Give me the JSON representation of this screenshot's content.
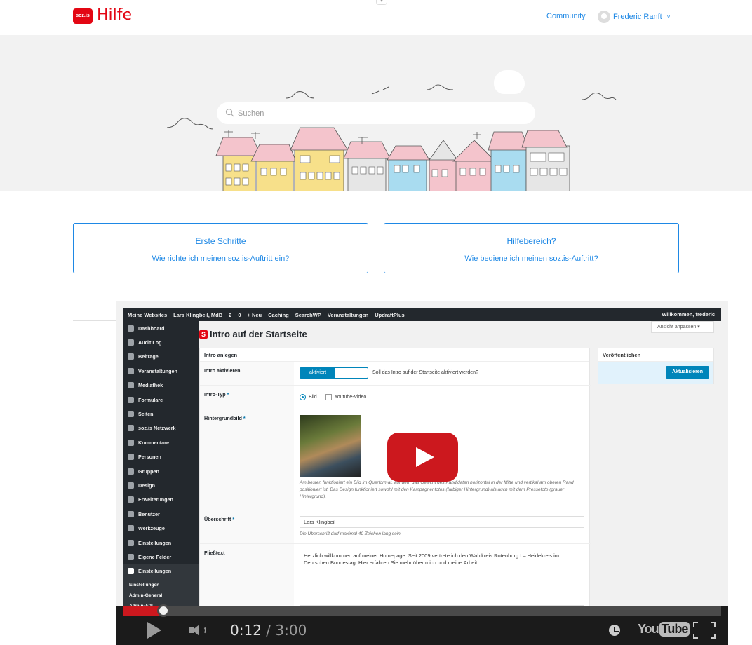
{
  "header": {
    "logo_mark": "soz.is",
    "logo_text": "Hilfe",
    "community": "Community",
    "user_name": "Frederic Ranft",
    "user_chevron": "˅"
  },
  "hero": {
    "search_placeholder": "Suchen"
  },
  "cards": [
    {
      "title": "Erste Schritte",
      "subtitle": "Wie richte ich meinen soz.is-Auftritt ein?"
    },
    {
      "title": "Hilfebereich?",
      "subtitle": "Wie bediene ich meinen soz.is-Auftritt?"
    }
  ],
  "video": {
    "adminbar": {
      "items": [
        "Meine Websites",
        "Lars Klingbeil, MdB",
        "2",
        "0",
        "+ Neu",
        "Caching",
        "SearchWP",
        "Veranstaltungen",
        "UpdraftPlus"
      ],
      "welcome": "Willkommen, frederic"
    },
    "sidebar": [
      "Dashboard",
      "Audit Log",
      "Beiträge",
      "Veranstaltungen",
      "Mediathek",
      "Formulare",
      "Seiten",
      "soz.is Netzwerk",
      "Kommentare",
      "Personen",
      "Gruppen",
      "Design",
      "Erweiterungen",
      "Benutzer",
      "Werkzeuge",
      "Einstellungen",
      "Eigene Felder",
      "Einstellungen"
    ],
    "submenu": [
      "Einstellungen",
      "Admin-General",
      "Admin-API"
    ],
    "screen_options": "Ansicht anpassen ▾",
    "page_title_mark": "S",
    "page_title": "Intro auf der Startseite",
    "panel_title": "Intro anlegen",
    "publish_title": "Veröffentlichen",
    "publish_button": "Aktualisieren",
    "rows": {
      "aktivieren_label": "Intro aktivieren",
      "toggle_on": "aktiviert",
      "toggle_question": "Soll das Intro auf der Startseite aktiviert werden?",
      "typ_label": "Intro-Typ",
      "typ_options": [
        "Bild",
        "Youtube-Video"
      ],
      "bg_label": "Hintergrundbild",
      "bg_hint": "Am besten funktioniert ein Bild im Querformat, auf dem das Gesicht des Kandidaten horizontal in der Mitte und vertikal am oberen Rand positioniert ist. Das Design funktioniert sowohl mit den Kampagnenfotos (farbiger Hintergrund) als auch mit dem Pressefoto (grauer Hintergrund).",
      "headline_label": "Überschrift",
      "headline_value": "Lars Klingbeil",
      "headline_hint": "Die Überschrift darf maximal 40 Zeichen lang sein.",
      "body_label": "Fließtext",
      "body_value": "Herzlich willkommen auf meiner Homepage. Seit 2009 vertrete ich den Wahlkreis Rotenburg I – Heidekreis im Deutschen Bundestag. Hier erfahren Sie mehr über mich und meine Arbeit."
    },
    "player": {
      "current_time": "0:12",
      "duration": "3:00",
      "progress_fraction": 0.0667,
      "logo_you": "You",
      "logo_tube": "Tube"
    }
  },
  "colors": {
    "brand_red": "#e30613",
    "link_blue": "#1e88e5",
    "wp_dark": "#23282d",
    "youtube_red": "#cc181e"
  }
}
